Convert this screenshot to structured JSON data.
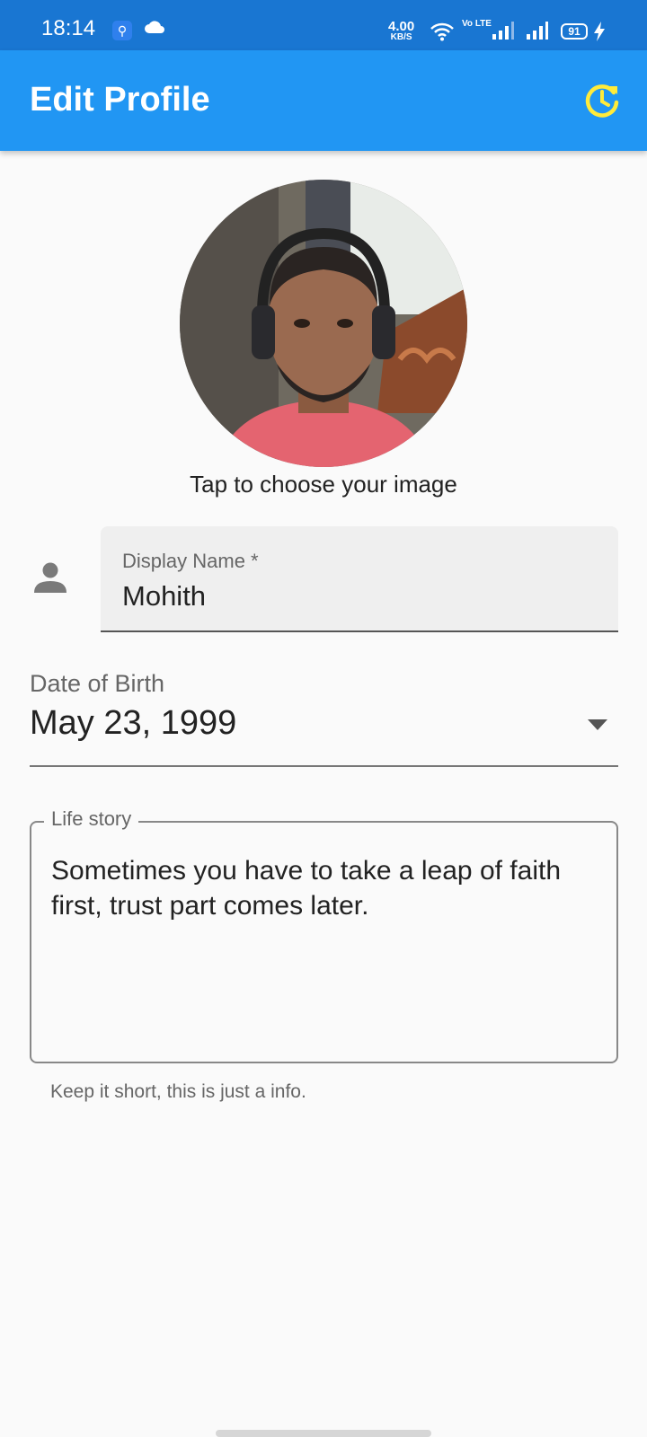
{
  "status_bar": {
    "time": "18:14",
    "net_speed_value": "4.00",
    "net_speed_unit": "KB/S",
    "volte_label": "Vo LTE",
    "battery": "91"
  },
  "app_bar": {
    "title": "Edit Profile",
    "action_icon": "restore-clock-icon",
    "action_icon_color": "#ffeb3b",
    "color": "#2196f3"
  },
  "avatar": {
    "caption": "Tap to choose your image"
  },
  "display_name": {
    "label": "Display Name *",
    "value": "Mohith"
  },
  "date_of_birth": {
    "label": "Date of Birth",
    "value": "May 23, 1999"
  },
  "life_story": {
    "label": "Life story",
    "value": "Sometimes you have to take a leap of faith first, trust part comes later.",
    "helper": "Keep it short, this is just a info."
  }
}
